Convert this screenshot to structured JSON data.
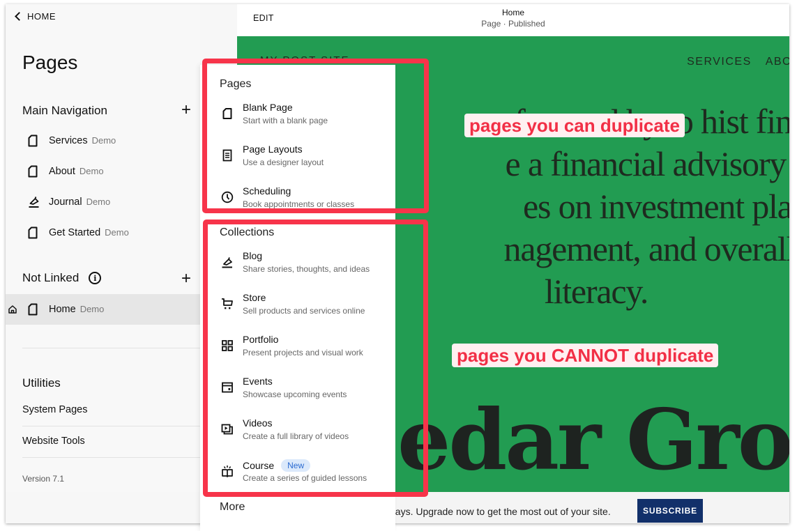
{
  "sidebar": {
    "back_label": "HOME",
    "title": "Pages",
    "main_navigation": {
      "title": "Main Navigation",
      "items": [
        {
          "label": "Services",
          "tag": "Demo",
          "icon": "page-icon"
        },
        {
          "label": "About",
          "tag": "Demo",
          "icon": "page-icon"
        },
        {
          "label": "Journal",
          "tag": "Demo",
          "icon": "blog-pen-icon"
        },
        {
          "label": "Get Started",
          "tag": "Demo",
          "icon": "page-icon"
        }
      ]
    },
    "not_linked": {
      "title": "Not Linked",
      "items": [
        {
          "label": "Home",
          "tag": "Demo",
          "icon": "page-icon",
          "is_homepage": true,
          "active": true
        }
      ]
    },
    "utilities": {
      "title": "Utilities",
      "items": [
        {
          "label": "System Pages"
        },
        {
          "label": "Website Tools"
        }
      ]
    },
    "version": "Version 7.1"
  },
  "topbar": {
    "edit_label": "EDIT",
    "page_title": "Home",
    "page_status": "Page · Published"
  },
  "preview": {
    "site_logo": "MY POST SITE",
    "nav_items": [
      "SERVICES",
      "ABO"
    ],
    "hero_lines": [
      "tforward by to hist financ",
      "e a financial advisory gro",
      "es on investment planni",
      "nagement, and overall fin",
      "literacy."
    ],
    "brand_text": "edar Gro",
    "colors": {
      "background": "#229c52",
      "text": "#1e2a1f"
    }
  },
  "banner": {
    "text": "days. Upgrade now to get the most out of your site.",
    "button_label": "SUBSCRIBE",
    "button_color": "#12306a"
  },
  "dropdown": {
    "pages_section": {
      "title": "Pages",
      "items": [
        {
          "title": "Blank Page",
          "desc": "Start with a blank page",
          "icon": "blank-page-icon"
        },
        {
          "title": "Page Layouts",
          "desc": "Use a designer layout",
          "icon": "layout-icon"
        },
        {
          "title": "Scheduling",
          "desc": "Book appointments or classes",
          "icon": "clock-icon"
        }
      ]
    },
    "collections_section": {
      "title": "Collections",
      "items": [
        {
          "title": "Blog",
          "desc": "Share stories, thoughts, and ideas",
          "icon": "blog-pen-icon"
        },
        {
          "title": "Store",
          "desc": "Sell products and services online",
          "icon": "cart-icon"
        },
        {
          "title": "Portfolio",
          "desc": "Present projects and visual work",
          "icon": "grid-icon"
        },
        {
          "title": "Events",
          "desc": "Showcase upcoming events",
          "icon": "calendar-icon"
        },
        {
          "title": "Videos",
          "desc": "Create a full library of videos",
          "icon": "video-icon"
        },
        {
          "title": "Course",
          "desc": "Create a series of guided lessons",
          "icon": "course-book-icon",
          "badge": "New"
        }
      ]
    },
    "more_section": {
      "title": "More"
    }
  },
  "annotations": {
    "can_duplicate": "pages you can duplicate",
    "cannot_duplicate": "pages you CANNOT duplicate",
    "color": "#f7344a"
  }
}
